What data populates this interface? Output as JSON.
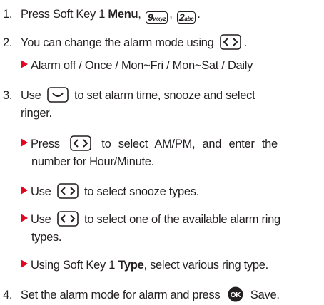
{
  "steps": {
    "s1": {
      "num": "1.",
      "text_a": "Press Soft Key 1",
      "bold": "Menu",
      "comma": ",",
      "key1_digit": "9",
      "key1_letters": "wxyz",
      "key2_digit": "2",
      "key2_letters": "abc",
      "end": "."
    },
    "s2": {
      "num": "2.",
      "text": "You can change the alarm mode using",
      "end": ".",
      "sub": "Alarm off / Once / Mon~Fri / Mon~Sat / Daily"
    },
    "s3": {
      "num": "3.",
      "text_a": "Use",
      "text_b": "to set alarm time, snooze and select",
      "text_c": "ringer.",
      "b1_a": "Press",
      "b1_b": "to select AM/PM, and enter the",
      "b1_c": "number for Hour/Minute.",
      "b2_a": "Use",
      "b2_b": "to select snooze types.",
      "b3_a": "Use",
      "b3_b": "to select one of the available alarm ring",
      "b3_c": "types.",
      "b4_a": "Using Soft Key 1",
      "b4_bold": "Type",
      "b4_b": ", select various ring type."
    },
    "s4": {
      "num": "4.",
      "text_a": "Set the alarm mode for alarm and press",
      "ok_label": "OK",
      "text_b": "Save."
    }
  },
  "icons": [
    "left-right-nav-key-icon",
    "down-nav-key-icon",
    "ok-key-icon",
    "red-triangle-bullet-icon"
  ],
  "colors": {
    "bullet": "#e40521",
    "text": "#231f20"
  }
}
